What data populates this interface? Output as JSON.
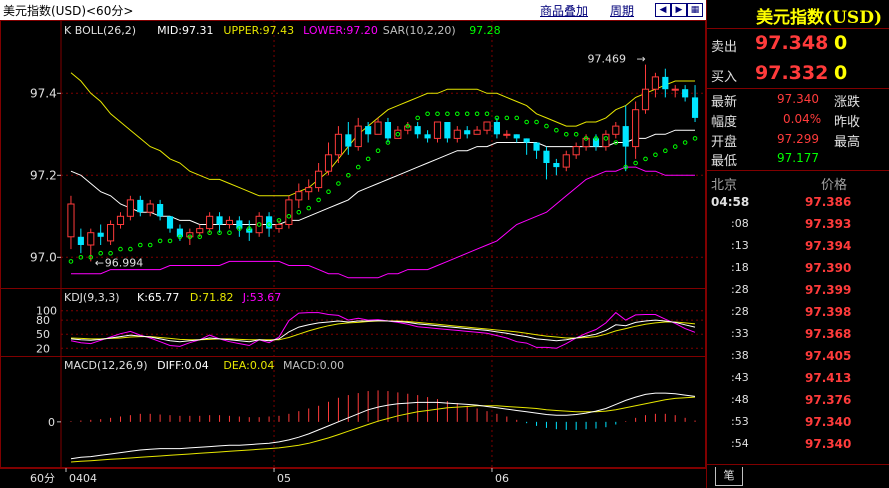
{
  "header": {
    "title": "美元指数(USD)<60分>",
    "links": [
      "商品叠加",
      "周期"
    ],
    "nav_icons": [
      "prev-icon",
      "next-icon",
      "expand-icon"
    ]
  },
  "chart_data": [
    {
      "type": "candlestick",
      "title": "K  BOLL(26,2)",
      "legend": [
        {
          "name": "MID:97.31",
          "color": "#ffffff"
        },
        {
          "name": "UPPER:97.43",
          "color": "#e6e600"
        },
        {
          "name": "LOWER:97.20",
          "color": "#ff00ff"
        },
        {
          "name": "SAR(10,2,20)",
          "color": "#c0c0c0"
        },
        {
          "name": "97.28",
          "color": "#00ff00"
        }
      ],
      "ylim": [
        96.93,
        97.53
      ],
      "yticks": [
        "97.4",
        "97.2",
        "97.0"
      ],
      "yticks_values": [
        97.4,
        97.2,
        97.0
      ],
      "annotations": [
        "97.469",
        "96.994"
      ],
      "candles": [
        [
          97.05,
          97.13,
          97.15,
          97.02
        ],
        [
          97.05,
          97.03,
          97.07,
          97.01
        ],
        [
          97.03,
          97.06,
          97.07,
          96.99
        ],
        [
          97.06,
          97.05,
          97.08,
          97.03
        ],
        [
          97.04,
          97.08,
          97.09,
          97.03
        ],
        [
          97.08,
          97.1,
          97.11,
          97.07
        ],
        [
          97.1,
          97.14,
          97.15,
          97.09
        ],
        [
          97.14,
          97.11,
          97.15,
          97.1
        ],
        [
          97.11,
          97.13,
          97.14,
          97.1
        ],
        [
          97.13,
          97.1,
          97.14,
          97.09
        ],
        [
          97.1,
          97.07,
          97.1,
          97.06
        ],
        [
          97.07,
          97.05,
          97.08,
          97.04
        ],
        [
          97.05,
          97.06,
          97.07,
          97.03
        ],
        [
          97.06,
          97.07,
          97.08,
          97.05
        ],
        [
          97.07,
          97.1,
          97.11,
          97.06
        ],
        [
          97.1,
          97.08,
          97.11,
          97.06
        ],
        [
          97.08,
          97.09,
          97.1,
          97.07
        ],
        [
          97.09,
          97.07,
          97.1,
          97.05
        ],
        [
          97.07,
          97.06,
          97.09,
          97.04
        ],
        [
          97.06,
          97.1,
          97.11,
          97.05
        ],
        [
          97.1,
          97.07,
          97.11,
          97.05
        ],
        [
          97.07,
          97.08,
          97.09,
          97.06
        ],
        [
          97.08,
          97.14,
          97.15,
          97.07
        ],
        [
          97.14,
          97.16,
          97.18,
          97.12
        ],
        [
          97.16,
          97.17,
          97.19,
          97.14
        ],
        [
          97.17,
          97.21,
          97.23,
          97.16
        ],
        [
          97.21,
          97.25,
          97.28,
          97.2
        ],
        [
          97.25,
          97.3,
          97.32,
          97.23
        ],
        [
          97.3,
          97.27,
          97.33,
          97.25
        ],
        [
          97.27,
          97.32,
          97.34,
          97.26
        ],
        [
          97.32,
          97.3,
          97.33,
          97.28
        ],
        [
          97.3,
          97.33,
          97.34,
          97.3
        ],
        [
          97.33,
          97.29,
          97.34,
          97.28
        ],
        [
          97.29,
          97.31,
          97.32,
          97.29
        ],
        [
          97.31,
          97.32,
          97.33,
          97.3
        ],
        [
          97.32,
          97.3,
          97.33,
          97.29
        ],
        [
          97.3,
          97.29,
          97.31,
          97.28
        ],
        [
          97.29,
          97.33,
          97.33,
          97.28
        ],
        [
          97.33,
          97.29,
          97.33,
          97.28
        ],
        [
          97.29,
          97.31,
          97.32,
          97.28
        ],
        [
          97.31,
          97.3,
          97.32,
          97.29
        ],
        [
          97.3,
          97.31,
          97.32,
          97.3
        ],
        [
          97.31,
          97.33,
          97.33,
          97.3
        ],
        [
          97.33,
          97.3,
          97.34,
          97.29
        ],
        [
          97.3,
          97.3,
          97.31,
          97.29
        ],
        [
          97.3,
          97.29,
          97.3,
          97.28
        ],
        [
          97.29,
          97.28,
          97.29,
          97.25
        ],
        [
          97.28,
          97.26,
          97.28,
          97.24
        ],
        [
          97.26,
          97.23,
          97.27,
          97.19
        ],
        [
          97.23,
          97.22,
          97.24,
          97.2
        ],
        [
          97.22,
          97.25,
          97.26,
          97.21
        ],
        [
          97.25,
          97.27,
          97.28,
          97.24
        ],
        [
          97.27,
          97.29,
          97.3,
          97.26
        ],
        [
          97.29,
          97.27,
          97.3,
          97.26
        ],
        [
          97.27,
          97.3,
          97.31,
          97.26
        ],
        [
          97.3,
          97.32,
          97.33,
          97.29
        ],
        [
          97.32,
          97.27,
          97.37,
          97.21
        ],
        [
          97.27,
          97.36,
          97.38,
          97.24
        ],
        [
          97.36,
          97.41,
          97.47,
          97.35
        ],
        [
          97.41,
          97.44,
          97.45,
          97.39
        ],
        [
          97.44,
          97.41,
          97.46,
          97.39
        ],
        [
          97.41,
          97.41,
          97.42,
          97.39
        ],
        [
          97.41,
          97.39,
          97.42,
          97.38
        ],
        [
          97.39,
          97.34,
          97.42,
          97.33
        ]
      ],
      "boll_upper": [
        97.45,
        97.43,
        97.4,
        97.38,
        97.35,
        97.33,
        97.31,
        97.29,
        97.27,
        97.26,
        97.24,
        97.23,
        97.21,
        97.2,
        97.19,
        97.19,
        97.18,
        97.17,
        97.16,
        97.15,
        97.15,
        97.15,
        97.15,
        97.16,
        97.17,
        97.19,
        97.21,
        97.24,
        97.27,
        97.3,
        97.32,
        97.34,
        97.36,
        97.37,
        97.38,
        97.39,
        97.4,
        97.4,
        97.41,
        97.41,
        97.41,
        97.41,
        97.4,
        97.4,
        97.39,
        97.38,
        97.37,
        97.35,
        97.34,
        97.33,
        97.32,
        97.32,
        97.33,
        97.33,
        97.34,
        97.36,
        97.37,
        97.39,
        97.4,
        97.41,
        97.42,
        97.43,
        97.43,
        97.43
      ],
      "boll_mid": [
        97.21,
        97.2,
        97.18,
        97.16,
        97.15,
        97.13,
        97.12,
        97.11,
        97.11,
        97.1,
        97.1,
        97.09,
        97.09,
        97.08,
        97.08,
        97.08,
        97.08,
        97.08,
        97.08,
        97.08,
        97.08,
        97.08,
        97.09,
        97.09,
        97.1,
        97.11,
        97.12,
        97.13,
        97.14,
        97.16,
        97.17,
        97.18,
        97.19,
        97.2,
        97.21,
        97.22,
        97.23,
        97.24,
        97.25,
        97.26,
        97.26,
        97.27,
        97.27,
        97.28,
        97.28,
        97.28,
        97.28,
        97.28,
        97.27,
        97.27,
        97.27,
        97.27,
        97.27,
        97.27,
        97.27,
        97.28,
        97.28,
        97.29,
        97.29,
        97.3,
        97.3,
        97.31,
        97.31,
        97.31
      ],
      "boll_lower": [
        96.96,
        96.96,
        96.96,
        96.96,
        96.97,
        96.97,
        96.97,
        96.97,
        96.97,
        96.97,
        96.98,
        96.98,
        96.98,
        96.98,
        96.98,
        96.98,
        96.99,
        96.99,
        96.99,
        96.99,
        96.99,
        96.99,
        96.98,
        96.98,
        96.98,
        96.97,
        96.96,
        96.96,
        96.95,
        96.95,
        96.95,
        96.95,
        96.96,
        96.96,
        96.97,
        96.97,
        96.97,
        96.98,
        96.99,
        97.0,
        97.01,
        97.02,
        97.03,
        97.04,
        97.06,
        97.08,
        97.09,
        97.1,
        97.11,
        97.13,
        97.15,
        97.17,
        97.19,
        97.2,
        97.21,
        97.21,
        97.22,
        97.22,
        97.21,
        97.21,
        97.2,
        97.2,
        97.2,
        97.2
      ],
      "sar": [
        96.99,
        97.0,
        97.0,
        97.01,
        97.01,
        97.02,
        97.02,
        97.03,
        97.03,
        97.04,
        97.04,
        97.05,
        97.05,
        97.05,
        97.06,
        97.06,
        97.06,
        97.07,
        97.07,
        97.08,
        97.08,
        97.09,
        97.1,
        97.11,
        97.12,
        97.14,
        97.16,
        97.18,
        97.2,
        97.22,
        97.24,
        97.26,
        97.28,
        97.3,
        97.32,
        97.34,
        97.35,
        97.35,
        97.35,
        97.35,
        97.35,
        97.35,
        97.35,
        97.34,
        97.34,
        97.34,
        97.33,
        97.33,
        97.32,
        97.31,
        97.3,
        97.3,
        97.29,
        97.29,
        97.29,
        97.28,
        97.22,
        97.23,
        97.24,
        97.25,
        97.26,
        97.27,
        97.28,
        97.29
      ]
    },
    {
      "type": "line",
      "title": "KDJ(9,3,3)",
      "legend": [
        {
          "name": "K:65.77",
          "color": "#ffffff"
        },
        {
          "name": "D:71.82",
          "color": "#e6e600"
        },
        {
          "name": "J:53.67",
          "color": "#ff00ff"
        }
      ],
      "ylim": [
        10,
        110
      ],
      "yticks": [
        "100",
        "80",
        "50",
        "20"
      ],
      "yticks_values": [
        100,
        80,
        50,
        20
      ],
      "K": [
        40,
        38,
        37,
        39,
        42,
        45,
        48,
        46,
        44,
        40,
        36,
        34,
        36,
        38,
        42,
        40,
        38,
        36,
        34,
        38,
        36,
        40,
        55,
        65,
        70,
        74,
        76,
        78,
        76,
        78,
        78,
        79,
        78,
        77,
        75,
        72,
        70,
        68,
        66,
        64,
        62,
        60,
        58,
        55,
        52,
        48,
        45,
        40,
        38,
        36,
        38,
        42,
        46,
        50,
        58,
        70,
        68,
        75,
        78,
        80,
        78,
        75,
        70,
        65
      ],
      "D": [
        42,
        41,
        40,
        40,
        41,
        42,
        44,
        45,
        45,
        43,
        41,
        39,
        38,
        38,
        39,
        40,
        40,
        39,
        38,
        38,
        38,
        38,
        43,
        50,
        57,
        63,
        68,
        72,
        74,
        75,
        77,
        78,
        78,
        78,
        77,
        75,
        73,
        71,
        69,
        67,
        65,
        63,
        61,
        59,
        57,
        55,
        52,
        49,
        46,
        44,
        42,
        42,
        43,
        45,
        50,
        57,
        62,
        67,
        71,
        74,
        76,
        76,
        74,
        72
      ],
      "J": [
        36,
        32,
        30,
        37,
        44,
        51,
        56,
        48,
        42,
        34,
        26,
        24,
        32,
        38,
        48,
        40,
        34,
        30,
        26,
        38,
        32,
        44,
        79,
        95,
        96,
        96,
        92,
        90,
        80,
        84,
        80,
        81,
        78,
        75,
        71,
        66,
        64,
        62,
        60,
        58,
        56,
        54,
        52,
        47,
        42,
        34,
        31,
        22,
        22,
        20,
        30,
        42,
        52,
        60,
        74,
        96,
        80,
        91,
        92,
        92,
        82,
        73,
        62,
        54
      ]
    },
    {
      "type": "bar",
      "title": "MACD(12,26,9)",
      "legend": [
        {
          "name": "DIFF:0.04",
          "color": "#ffffff"
        },
        {
          "name": "DEA:0.04",
          "color": "#e6e600"
        },
        {
          "name": "MACD:0.00",
          "color": "#c0c0c0"
        }
      ],
      "ylim": [
        -0.06,
        0.07
      ],
      "yticks": [
        "0"
      ],
      "yticks_values": [
        0
      ],
      "MACD": [
        0.001,
        0.002,
        0.003,
        0.004,
        0.006,
        0.008,
        0.01,
        0.012,
        0.012,
        0.011,
        0.01,
        0.009,
        0.009,
        0.009,
        0.01,
        0.01,
        0.009,
        0.008,
        0.007,
        0.007,
        0.008,
        0.009,
        0.012,
        0.016,
        0.02,
        0.024,
        0.03,
        0.036,
        0.04,
        0.043,
        0.046,
        0.047,
        0.046,
        0.044,
        0.042,
        0.04,
        0.037,
        0.034,
        0.031,
        0.028,
        0.024,
        0.02,
        0.016,
        0.012,
        0.008,
        0.003,
        -0.002,
        -0.006,
        -0.009,
        -0.011,
        -0.012,
        -0.012,
        -0.011,
        -0.01,
        -0.008,
        -0.004,
        0.001,
        0.006,
        0.01,
        0.012,
        0.012,
        0.01,
        0.006,
        0.002
      ],
      "DIFF": [
        -0.055,
        -0.053,
        -0.052,
        -0.05,
        -0.048,
        -0.046,
        -0.044,
        -0.042,
        -0.041,
        -0.04,
        -0.04,
        -0.04,
        -0.039,
        -0.038,
        -0.037,
        -0.036,
        -0.035,
        -0.035,
        -0.034,
        -0.033,
        -0.032,
        -0.03,
        -0.027,
        -0.023,
        -0.018,
        -0.012,
        -0.006,
        0.0,
        0.006,
        0.012,
        0.018,
        0.022,
        0.025,
        0.027,
        0.028,
        0.029,
        0.029,
        0.029,
        0.028,
        0.027,
        0.026,
        0.025,
        0.023,
        0.021,
        0.019,
        0.017,
        0.015,
        0.013,
        0.011,
        0.01,
        0.01,
        0.011,
        0.013,
        0.016,
        0.02,
        0.026,
        0.032,
        0.037,
        0.041,
        0.043,
        0.043,
        0.042,
        0.04,
        0.038
      ],
      "DEA": [
        -0.06,
        -0.059,
        -0.058,
        -0.057,
        -0.056,
        -0.055,
        -0.054,
        -0.053,
        -0.052,
        -0.051,
        -0.05,
        -0.049,
        -0.048,
        -0.047,
        -0.046,
        -0.045,
        -0.044,
        -0.043,
        -0.042,
        -0.041,
        -0.04,
        -0.039,
        -0.037,
        -0.035,
        -0.032,
        -0.028,
        -0.024,
        -0.019,
        -0.014,
        -0.009,
        -0.004,
        0.001,
        0.005,
        0.009,
        0.012,
        0.015,
        0.017,
        0.019,
        0.021,
        0.022,
        0.023,
        0.024,
        0.024,
        0.024,
        0.023,
        0.022,
        0.021,
        0.02,
        0.018,
        0.017,
        0.016,
        0.015,
        0.015,
        0.015,
        0.016,
        0.018,
        0.021,
        0.024,
        0.027,
        0.03,
        0.033,
        0.035,
        0.036,
        0.037
      ]
    }
  ],
  "x_axis": {
    "corner_label": "60分",
    "ticks": [
      "0404",
      "05",
      "06"
    ]
  },
  "quote_panel": {
    "title": "美元指数(USD)",
    "sell_label": "卖出",
    "sell_price": "97.348",
    "sell_vol": "0",
    "buy_label": "买入",
    "buy_price": "97.332",
    "buy_vol": "0",
    "stats": [
      {
        "label": "最新",
        "value": "97.340",
        "color": "#ff3b3b",
        "label2": "涨跌"
      },
      {
        "label": "幅度",
        "value": "0.04%",
        "color": "#ff3b3b",
        "label2": "昨收"
      },
      {
        "label": "开盘",
        "value": "97.299",
        "color": "#ff3b3b",
        "label2": "最高"
      },
      {
        "label": "最低",
        "value": "97.177",
        "color": "#00ff00",
        "label2": ""
      }
    ],
    "ticks_header": {
      "left": "北京",
      "right": "价格"
    },
    "ticks": [
      {
        "time": "04:58",
        "price": "97.386"
      },
      {
        "time": ":08",
        "price": "97.393"
      },
      {
        "time": ":13",
        "price": "97.394"
      },
      {
        "time": ":18",
        "price": "97.390"
      },
      {
        "time": ":28",
        "price": "97.399"
      },
      {
        "time": ":28",
        "price": "97.398"
      },
      {
        "time": ":33",
        "price": "97.368"
      },
      {
        "time": ":38",
        "price": "97.405"
      },
      {
        "time": ":43",
        "price": "97.413"
      },
      {
        "time": ":48",
        "price": "97.376"
      },
      {
        "time": ":53",
        "price": "97.340"
      },
      {
        "time": ":54",
        "price": "97.340"
      }
    ],
    "footer_tab": "笔"
  }
}
